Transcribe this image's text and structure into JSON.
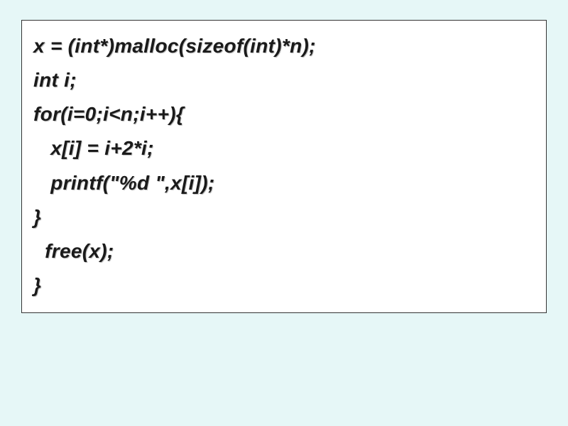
{
  "code": {
    "lines": [
      "x = (int*)malloc(sizeof(int)*n);",
      "int i;",
      "for(i=0;i<n;i++){",
      "   x[i] = i+2*i;",
      "   printf(\"%d \",x[i]);",
      "}",
      "  free(x);",
      "}"
    ]
  }
}
